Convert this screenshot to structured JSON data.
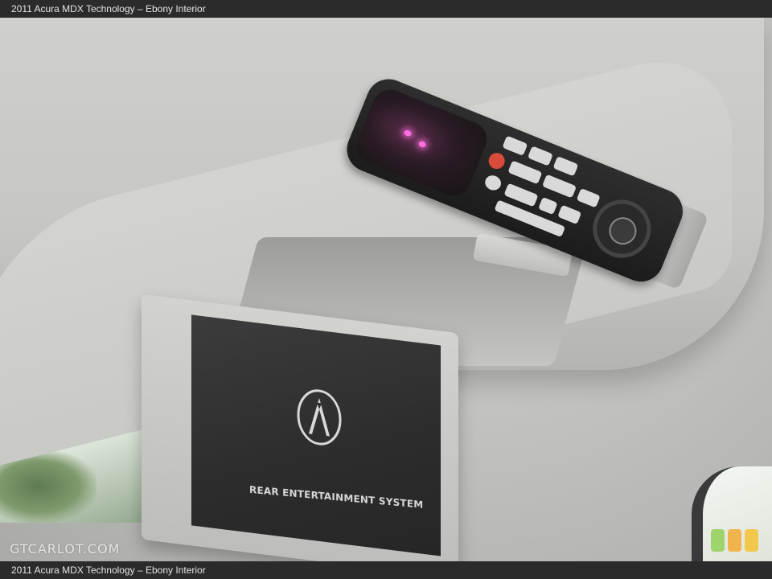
{
  "caption": {
    "top": "2011 Acura MDX Technology – Ebony Interior",
    "bottom": "2011 Acura MDX Technology – Ebony Interior"
  },
  "screen": {
    "title": "REAR ENTERTAINMENT SYSTEM"
  },
  "watermark": "GTCARLOT.COM",
  "colors": {
    "headliner": "#c9c9c6",
    "screen": "#2e2e2e",
    "led": "#ff6fe0",
    "caption_bar": "#2b2b2b"
  }
}
